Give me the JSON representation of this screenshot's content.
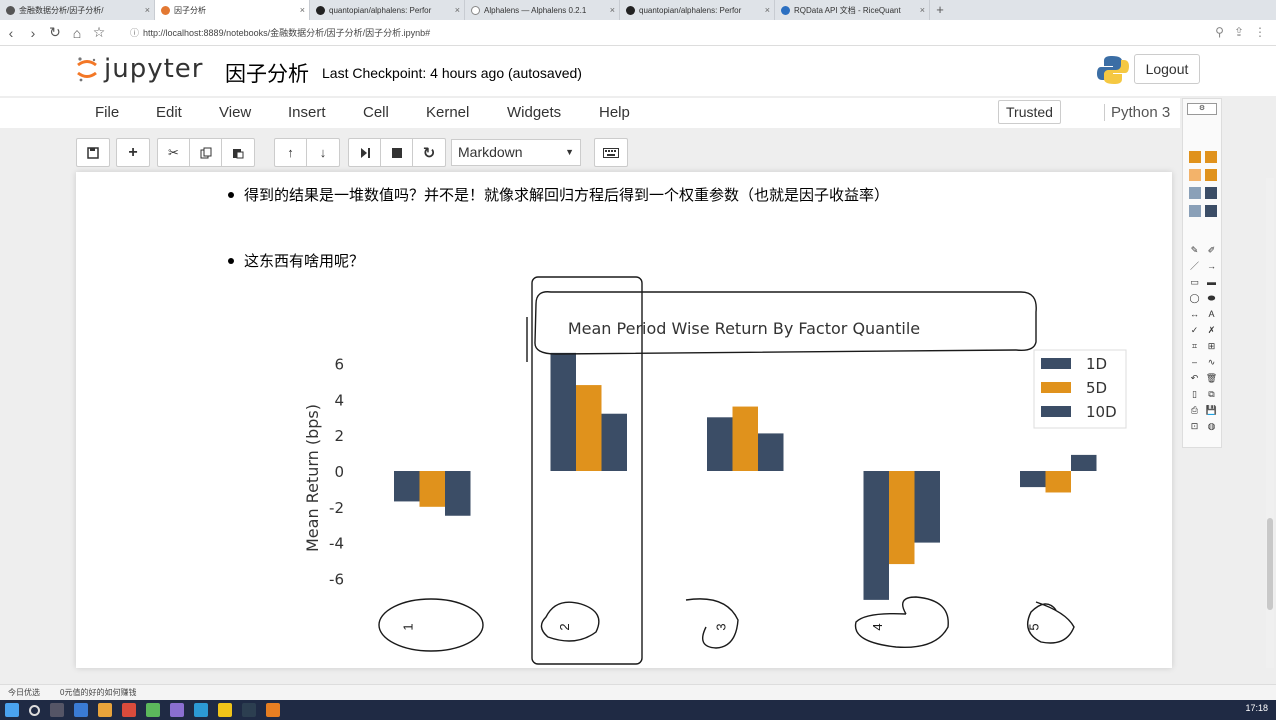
{
  "browser": {
    "tabs": [
      {
        "label": "金融数据分析/因子分析/"
      },
      {
        "label": "因子分析"
      },
      {
        "label": "quantopian/alphalens: Perfor"
      },
      {
        "label": "Alphalens — Alphalens 0.2.1"
      },
      {
        "label": "quantopian/alphalens: Perfor"
      },
      {
        "label": "RQData API 文档 - RiceQuant"
      }
    ],
    "new_tab": "+",
    "url": "http://localhost:8889/notebooks/金融数据分析/因子分析/因子分析.ipynb#"
  },
  "jupyter": {
    "logo_text": "jupyter",
    "notebook_name": "因子分析",
    "checkpoint": "Last Checkpoint: 4 hours ago (autosaved)",
    "logout": "Logout",
    "menu": [
      "File",
      "Edit",
      "View",
      "Insert",
      "Cell",
      "Kernel",
      "Widgets",
      "Help"
    ],
    "trusted": "Trusted",
    "kernel": "Python 3",
    "cell_type": "Markdown"
  },
  "content": {
    "bullet1": "得到的结果是一堆数值吗？并不是！就像求解回归方程后得到一个权重参数（也就是因子收益率）",
    "bullet2": "这东西有啥用呢？"
  },
  "chart_data": {
    "type": "bar",
    "title": "Mean Period Wise Return By Factor Quantile",
    "ylabel": "Mean Return (bps)",
    "xlabel": "",
    "categories": [
      "1",
      "2",
      "3",
      "4",
      "5"
    ],
    "ylim": [
      -7,
      7
    ],
    "yticks": [
      6,
      4,
      2,
      0,
      -2,
      -4,
      -6
    ],
    "series": [
      {
        "name": "1D",
        "color": "#3b4d66",
        "values": [
          -1.7,
          6.6,
          3.0,
          -7.2,
          -0.9
        ]
      },
      {
        "name": "5D",
        "color": "#e0921c",
        "values": [
          -2.0,
          4.8,
          3.6,
          -5.2,
          -1.2
        ]
      },
      {
        "name": "10D",
        "color": "#3b4d66",
        "values": [
          -2.5,
          3.2,
          2.1,
          -4.0,
          0.9
        ]
      }
    ],
    "legend_position": "top-right",
    "grid": false
  },
  "status": {
    "left1": "今日优选",
    "left2": "0元值的好的如何赚钱",
    "time": "17:18"
  }
}
